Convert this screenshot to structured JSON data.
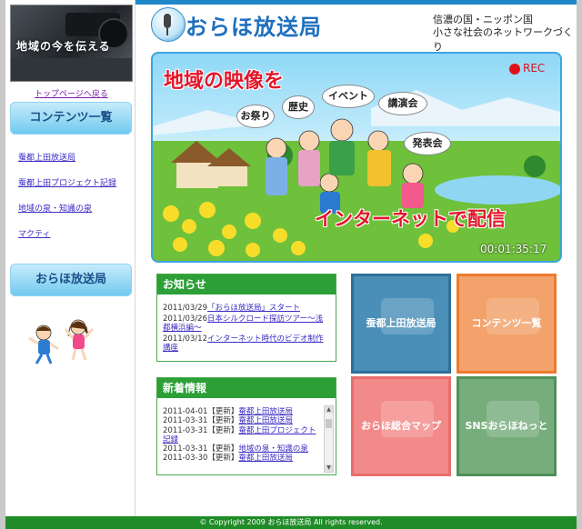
{
  "sidebar": {
    "photo_caption": "地域の今を伝える",
    "top_link": "トップページへ戻る",
    "contents_heading": "コンテンツ一覧",
    "links": [
      "蚕都上田放送局",
      "蚕都上田プロジェクト記録",
      "地域の泉・知識の泉",
      "マクティ"
    ],
    "station_heading": "おらほ放送局"
  },
  "header": {
    "title": "おらほ放送局",
    "tagline1": "信濃の国・ニッポン国",
    "tagline2": "小さな社会のネットワークづくり"
  },
  "hero": {
    "title": "地域の映像を",
    "bubbles": [
      "お祭り",
      "歴史",
      "イベント",
      "講演会",
      "発表会"
    ],
    "bottom_text": "インターネットで配信",
    "rec_label": "REC",
    "timecode": "00:01:35:17"
  },
  "news": {
    "heading": "お知らせ",
    "items": [
      {
        "date": "2011/03/29",
        "text": "「おらほ放送局」スタート"
      },
      {
        "date": "2011/03/26",
        "text": "日本シルクロード探訪ツアー～浅都横浜編～"
      },
      {
        "date": "2011/03/12",
        "text": "インターネット時代のビデオ制作講座"
      }
    ]
  },
  "latest": {
    "heading": "新着情報",
    "items": [
      {
        "date": "2011-04-01",
        "tag": "【更新】",
        "text": "蚕都上田放送局"
      },
      {
        "date": "2011-03-31",
        "tag": "【更新】",
        "text": "蚕都上田放送局"
      },
      {
        "date": "2011-03-31",
        "tag": "【更新】",
        "text": "蚕都上田プロジェクト記録"
      },
      {
        "date": "2011-03-31",
        "tag": "【更新】",
        "text": "地域の泉・知識の泉"
      },
      {
        "date": "2011-03-30",
        "tag": "【更新】",
        "text": "蚕都上田放送局"
      }
    ]
  },
  "tiles": [
    "蚕都上田放送局",
    "コンテンツ一覧",
    "おらほ総合マップ",
    "SNSおらほねっと"
  ],
  "footer": "© Copyright 2009 おらほ放送局 All rights reserved.",
  "colors": {
    "accent_blue": "#1e88c8",
    "green": "#2c9f37",
    "rec_red": "#e3101c"
  }
}
